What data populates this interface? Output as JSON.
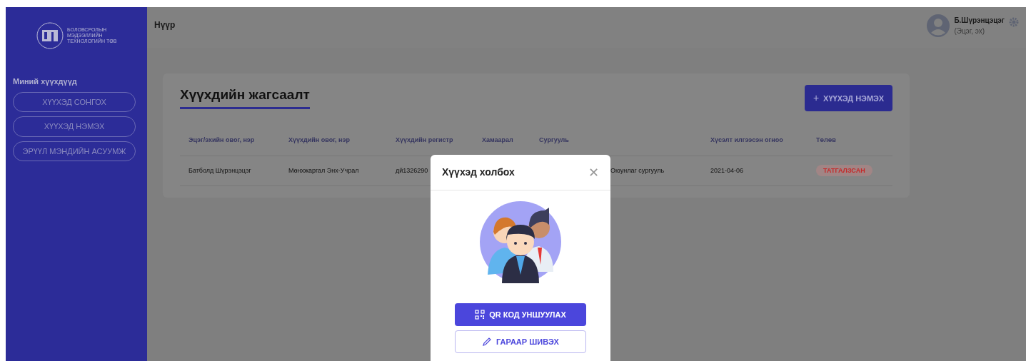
{
  "sidebar": {
    "logo_text": "БОЛОВСРОЛЫН МЭДЭЭЛЛИЙН ТЕХНОЛОГИЙН ТӨВ",
    "section_title": "Миний хүүхдүүд",
    "items": [
      {
        "label": "ХҮҮХЭД СОНГОХ"
      },
      {
        "label": "ХҮҮХЭД НЭМЭХ"
      },
      {
        "label": "ЭРҮҮЛ МЭНДИЙН АСУУМЖ"
      }
    ]
  },
  "topbar": {
    "breadcrumb": "Нүүр",
    "user_name": "Б.Шүрэнцэцэг",
    "user_role": "(Эцэг, эх)"
  },
  "card": {
    "title": "Хүүхдийн жагсаалт",
    "add_button": "ХҮҮХЭД НЭМЭХ",
    "add_button_icon": "+",
    "table": {
      "columns": [
        "Эцэг/эхийн овог, нэр",
        "Хүүхдийн овог, нэр",
        "Хүүхдийн регистр",
        "Хамаарал",
        "Сургууль",
        "Хүсэлт илгээсэн огноо",
        "Төлөв"
      ],
      "rows": [
        {
          "cells": [
            "Батболд Шүрэнцэцэг",
            "Мөнхжаргал Энх-Учрал",
            "дй1326290",
            "",
            "Оюунлаг сургууль",
            "2021-04-06"
          ],
          "status": {
            "label": "ТАТГАЛЗСАН",
            "color": "#c62828"
          }
        }
      ]
    }
  },
  "modal": {
    "title": "Хүүхэд холбох",
    "close": "✕",
    "buttons": [
      {
        "label": "QR КОД УНШУУЛАХ",
        "kind": "qr"
      },
      {
        "label": "ГАРААР ШИВЭХ",
        "kind": "manual"
      }
    ]
  }
}
